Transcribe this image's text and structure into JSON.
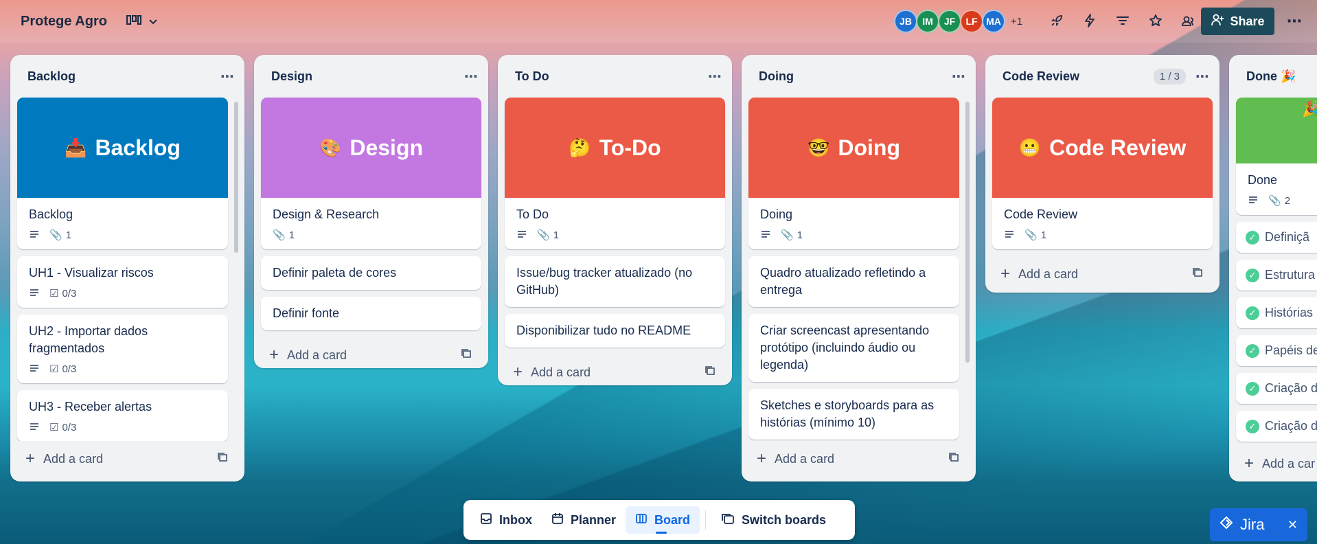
{
  "header": {
    "board_title": "Protege Agro",
    "avatars": [
      {
        "initials": "JB",
        "color": "#1f6fd1"
      },
      {
        "initials": "IM",
        "color": "#1a8f53"
      },
      {
        "initials": "JF",
        "color": "#1a8f53"
      },
      {
        "initials": "LF",
        "color": "#d83a1b"
      },
      {
        "initials": "MA",
        "color": "#1f6fd1"
      }
    ],
    "more_members": "+1",
    "share_label": "Share"
  },
  "lists": [
    {
      "title": "Backlog",
      "cover": {
        "emoji": "📥",
        "text": "Backlog",
        "color": "#0079bf"
      },
      "cover_card": {
        "title": "Backlog",
        "attachments": "1"
      },
      "cards": [
        {
          "title": "UH1 - Visualizar riscos",
          "checklist": "0/3"
        },
        {
          "title": "UH2 - Importar dados fragmentados",
          "checklist": "0/3"
        },
        {
          "title": "UH3 - Receber alertas",
          "checklist": "0/3"
        }
      ],
      "add_label": "Add a card"
    },
    {
      "title": "Design",
      "cover": {
        "emoji": "🎨",
        "text": "Design",
        "color": "#c377e0"
      },
      "cover_card": {
        "title": "Design & Research",
        "attachments": "1"
      },
      "cards": [
        {
          "title": "Definir paleta de cores"
        },
        {
          "title": "Definir fonte"
        }
      ],
      "add_label": "Add a card"
    },
    {
      "title": "To Do",
      "cover": {
        "emoji": "🤔",
        "text": "To-Do",
        "color": "#eb5a46"
      },
      "cover_card": {
        "title": "To Do",
        "attachments": "1"
      },
      "cards": [
        {
          "title": "Issue/bug tracker atualizado (no GitHub)"
        },
        {
          "title": "Disponibilizar tudo no README"
        }
      ],
      "add_label": "Add a card"
    },
    {
      "title": "Doing",
      "cover": {
        "emoji": "🤓",
        "text": "Doing",
        "color": "#eb5a46"
      },
      "cover_card": {
        "title": "Doing",
        "attachments": "1"
      },
      "cards": [
        {
          "title": "Quadro atualizado refletindo a entrega"
        },
        {
          "title": "Criar screencast apresentando protótipo (incluindo áudio ou legenda)"
        },
        {
          "title": "Sketches e storyboards para as histórias (mínimo 10)"
        }
      ],
      "add_label": "Add a card"
    },
    {
      "title": "Code Review",
      "count": "1 / 3",
      "cover": {
        "emoji": "😬",
        "text": "Code Review",
        "color": "#eb5a46"
      },
      "cover_card": {
        "title": "Code Review",
        "attachments": "1"
      },
      "add_label": "Add a card"
    },
    {
      "title": "Done 🎉",
      "cover": {
        "emoji": "🎉",
        "color": "#61bd4f"
      },
      "cover_card": {
        "title": "Done",
        "attachments": "2"
      },
      "items": [
        "Definiçã",
        "Estrutura",
        "Histórias",
        "Papéis de",
        "Criação d",
        "Criação d"
      ],
      "add_label": "Add a car"
    }
  ],
  "bottom_nav": {
    "inbox": "Inbox",
    "planner": "Planner",
    "board": "Board",
    "switch": "Switch boards"
  },
  "jira": {
    "label": "Jira"
  }
}
